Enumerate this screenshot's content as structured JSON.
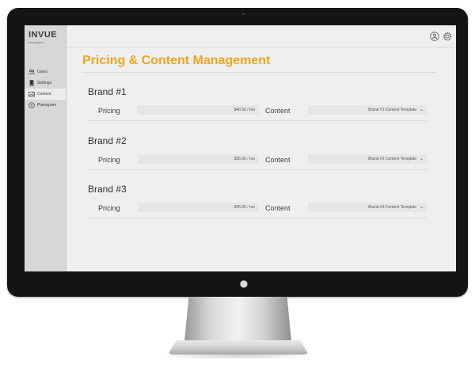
{
  "app": {
    "logo_text": "INVUE",
    "logo_tagline": "InterOptics"
  },
  "sidebar": {
    "items": [
      {
        "label": "Users",
        "icon": "users-icon",
        "active": false
      },
      {
        "label": "Settings",
        "icon": "device-icon",
        "active": false
      },
      {
        "label": "Content",
        "icon": "image-icon",
        "active": true
      },
      {
        "label": "Planogram",
        "icon": "planogram-icon",
        "active": false
      }
    ]
  },
  "topbar": {
    "icons": [
      "user-icon",
      "gear-icon"
    ]
  },
  "page": {
    "title": "Pricing & Content Management"
  },
  "brands": [
    {
      "name": "Brand #1",
      "pricing_label": "Pricing",
      "pricing_value": "$40.00 / mo",
      "content_label": "Content",
      "content_value": "Brand #1 Content Template"
    },
    {
      "name": "Brand #2",
      "pricing_label": "Pricing",
      "pricing_value": "$35.00 / mo",
      "content_label": "Content",
      "content_value": "Brand #2 Content Template"
    },
    {
      "name": "Brand #3",
      "pricing_label": "Pricing",
      "pricing_value": "$45.00 / mo",
      "content_label": "Content",
      "content_value": "Brand #3 Content Template"
    }
  ],
  "colors": {
    "accent": "#f0a51c",
    "sidebar_bg": "#d7d7d7",
    "screen_bg": "#efefef",
    "bezel": "#141414"
  }
}
